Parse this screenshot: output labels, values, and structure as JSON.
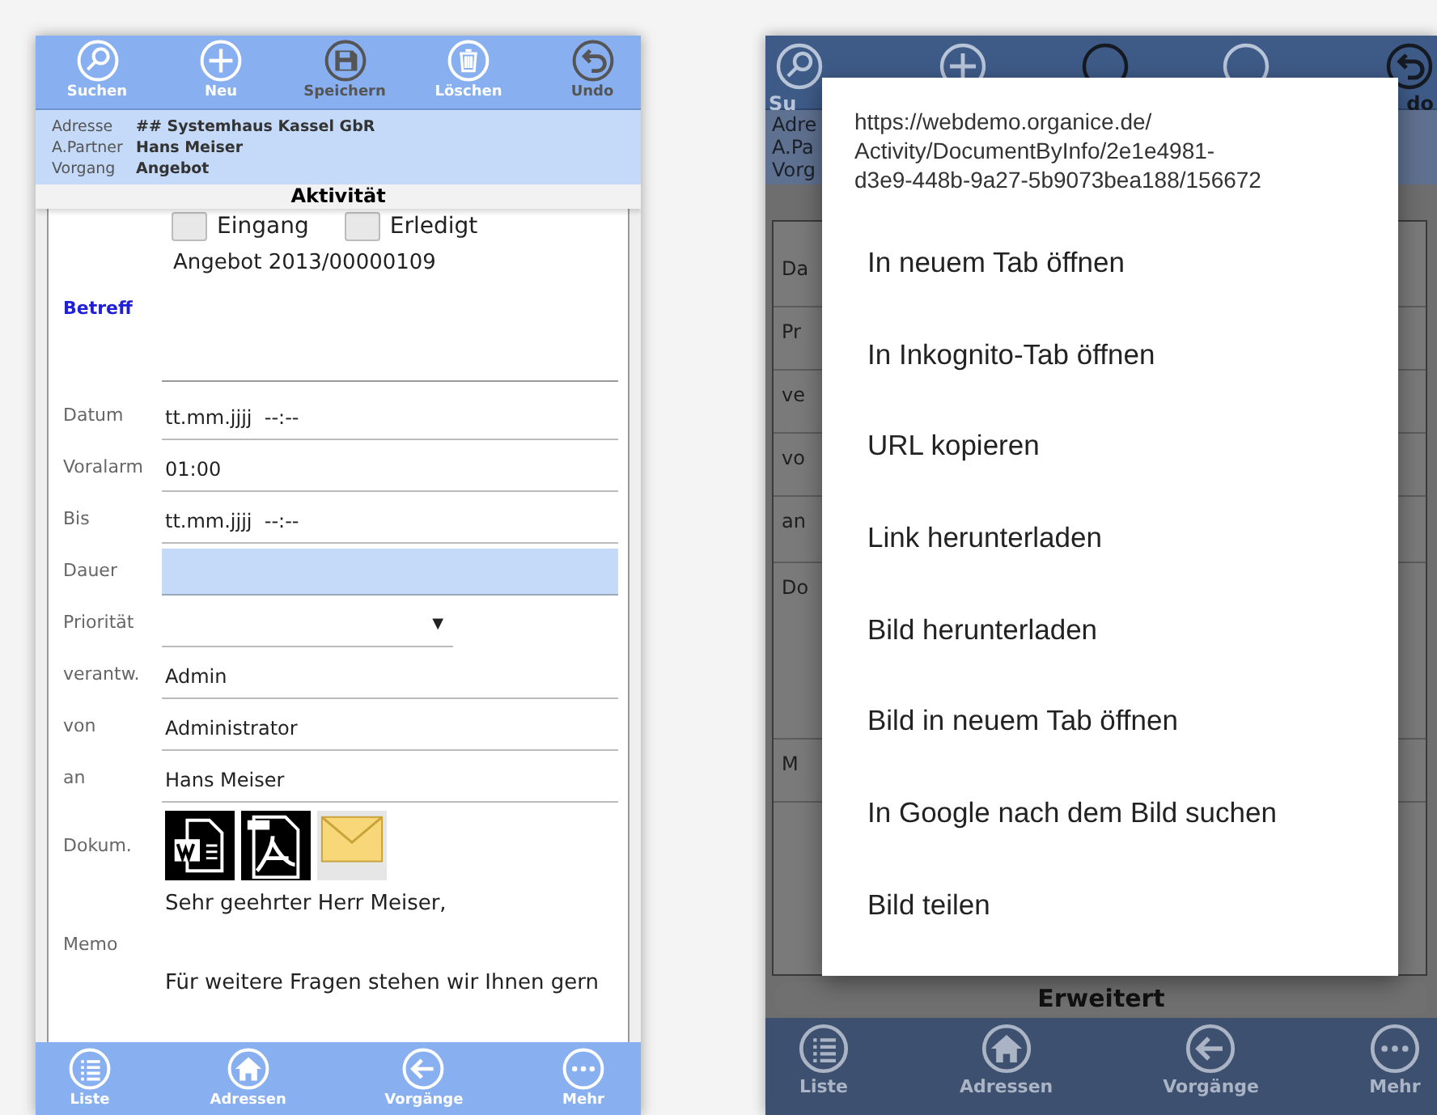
{
  "left_phone": {
    "toolbar": [
      {
        "label": "Suchen",
        "disabled": false
      },
      {
        "label": "Neu",
        "disabled": false
      },
      {
        "label": "Speichern",
        "disabled": true
      },
      {
        "label": "Löschen",
        "disabled": false
      },
      {
        "label": "Undo",
        "disabled": true
      }
    ],
    "info": [
      {
        "label": "Adresse",
        "value": "## Systemhaus Kassel GbR"
      },
      {
        "label": "A.Partner",
        "value": "Hans Meiser"
      },
      {
        "label": "Vorgang",
        "value": "Angebot"
      }
    ],
    "title": "Aktivität",
    "checkboxes": [
      {
        "label": "Eingang",
        "checked": false
      },
      {
        "label": "Erledigt",
        "checked": false
      }
    ],
    "reference": "Angebot 2013/00000109",
    "fields": [
      {
        "kind": "textarea",
        "label": "Betreff"
      },
      {
        "kind": "text",
        "label": "Datum",
        "value": "tt.mm.jjjj  --:--"
      },
      {
        "kind": "text",
        "label": "Voralarm",
        "value": "01:00"
      },
      {
        "kind": "text",
        "label": "Bis",
        "value": "tt.mm.jjjj  --:--"
      },
      {
        "kind": "highlight",
        "label": "Dauer"
      },
      {
        "kind": "select",
        "label": "Priorität",
        "arrow": "▼"
      },
      {
        "kind": "text",
        "label": "verantw.",
        "value": "Admin"
      },
      {
        "kind": "text",
        "label": "von",
        "value": "Administrator"
      },
      {
        "kind": "text",
        "label": "an",
        "value": "Hans Meiser"
      },
      {
        "kind": "documents",
        "label": "Dokum."
      },
      {
        "kind": "memo",
        "label": "Memo",
        "lines": [
          "Sehr geehrter Herr Meiser,",
          "Für weitere Fragen stehen wir Ihnen gern"
        ]
      }
    ],
    "bottom_nav": [
      {
        "label": "Liste"
      },
      {
        "label": "Adressen"
      },
      {
        "label": "Vorgänge"
      },
      {
        "label": "Mehr"
      }
    ]
  },
  "right_phone": {
    "toolbar": [
      {
        "label": "Su",
        "disabled": false
      },
      {
        "disabled": false
      },
      {
        "disabled": true
      },
      {
        "disabled": false
      },
      {
        "label": "do",
        "disabled": true
      }
    ],
    "info_labels": [
      "Adre",
      "A.Pa",
      "Vorg"
    ],
    "form_labels": [
      "Da",
      "Pr",
      "ve",
      "vo",
      "an",
      "Do",
      "M"
    ],
    "button": "Erweitert",
    "bottom_nav": [
      {
        "label": "Liste"
      },
      {
        "label": "Adressen"
      },
      {
        "label": "Vorgänge"
      },
      {
        "label": "Mehr"
      }
    ],
    "dialog": {
      "url": "https://webdemo.organice.de/\nActivity/DocumentByInfo/2e1e4981-\nd3e9-448b-9a27-5b9073bea188/156672",
      "items": [
        "In neuem Tab öffnen",
        "In Inkognito-Tab öffnen",
        "URL kopieren",
        "Link herunterladen",
        "Bild herunterladen",
        "Bild in neuem Tab öffnen",
        "In Google nach dem Bild suchen",
        "Bild teilen"
      ]
    }
  }
}
